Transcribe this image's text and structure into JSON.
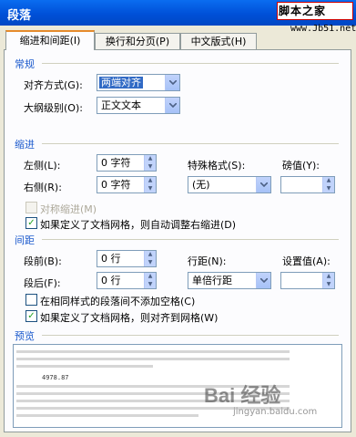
{
  "window": {
    "title": "段落"
  },
  "watermark": {
    "text": "脚本之家",
    "url": "www.Jb51.net"
  },
  "tabs": [
    {
      "label": "缩进和间距(I)"
    },
    {
      "label": "换行和分页(P)"
    },
    {
      "label": "中文版式(H)"
    }
  ],
  "general": {
    "title": "常规",
    "alignment_label": "对齐方式(G):",
    "alignment_value": "两端对齐",
    "outline_label": "大纲级别(O):",
    "outline_value": "正文文本"
  },
  "indent": {
    "title": "缩进",
    "left_label": "左侧(L):",
    "left_value": "0 字符",
    "right_label": "右侧(R):",
    "right_value": "0 字符",
    "special_label": "特殊格式(S):",
    "special_value": "(无)",
    "by_label": "磅值(Y):",
    "by_value": "",
    "mirror_label": "对称缩进(M)",
    "auto_adjust_label": "如果定义了文档网格，则自动调整右缩进(D)"
  },
  "spacing": {
    "title": "间距",
    "before_label": "段前(B):",
    "before_value": "0 行",
    "after_label": "段后(F):",
    "after_value": "0 行",
    "line_label": "行距(N):",
    "line_value": "单倍行距",
    "at_label": "设置值(A):",
    "at_value": "",
    "no_space_label": "在相同样式的段落间不添加空格(C)",
    "snap_grid_label": "如果定义了文档网格，则对齐到网格(W)"
  },
  "preview": {
    "title": "预览",
    "sample_number": "4978.87"
  },
  "overlay": {
    "brand": "Bai 经验",
    "brand_sub": "jingyan.baidu.com"
  },
  "icons": {
    "checked": "check-mark",
    "dropdown": "chevron-down",
    "spin": "up-down-arrows"
  }
}
